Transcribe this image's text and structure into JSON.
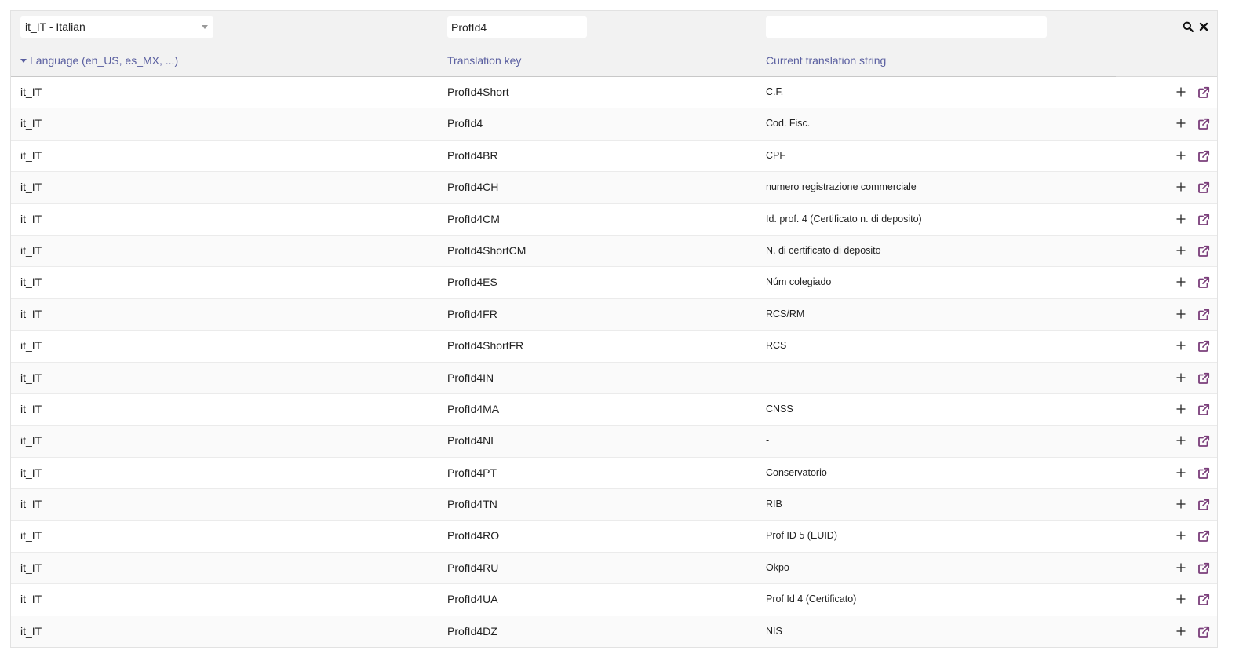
{
  "filters": {
    "language_select": "it_IT - Italian",
    "key_value": "ProfId4",
    "string_value": "",
    "search_icon": "search-icon",
    "clear_icon": "close-icon"
  },
  "columns": {
    "language": "Language (en_US, es_MX, ...)",
    "key": "Translation key",
    "string": "Current translation string"
  },
  "row_actions": {
    "add_icon": "plus-icon",
    "edit_icon": "external-link-icon",
    "accent_color": "#7a3e7a"
  },
  "rows": [
    {
      "lang": "it_IT",
      "key": "ProfId4Short",
      "string": "C.F."
    },
    {
      "lang": "it_IT",
      "key": "ProfId4",
      "string": "Cod. Fisc."
    },
    {
      "lang": "it_IT",
      "key": "ProfId4BR",
      "string": "CPF"
    },
    {
      "lang": "it_IT",
      "key": "ProfId4CH",
      "string": "numero registrazione commerciale"
    },
    {
      "lang": "it_IT",
      "key": "ProfId4CM",
      "string": "Id. prof. 4 (Certificato n. di deposito)"
    },
    {
      "lang": "it_IT",
      "key": "ProfId4ShortCM",
      "string": "N. di certificato di deposito"
    },
    {
      "lang": "it_IT",
      "key": "ProfId4ES",
      "string": "Núm colegiado"
    },
    {
      "lang": "it_IT",
      "key": "ProfId4FR",
      "string": "RCS/RM"
    },
    {
      "lang": "it_IT",
      "key": "ProfId4ShortFR",
      "string": "RCS"
    },
    {
      "lang": "it_IT",
      "key": "ProfId4IN",
      "string": "-"
    },
    {
      "lang": "it_IT",
      "key": "ProfId4MA",
      "string": "CNSS"
    },
    {
      "lang": "it_IT",
      "key": "ProfId4NL",
      "string": "-"
    },
    {
      "lang": "it_IT",
      "key": "ProfId4PT",
      "string": "Conservatorio"
    },
    {
      "lang": "it_IT",
      "key": "ProfId4TN",
      "string": "RIB"
    },
    {
      "lang": "it_IT",
      "key": "ProfId4RO",
      "string": "Prof ID 5 (EUID)"
    },
    {
      "lang": "it_IT",
      "key": "ProfId4RU",
      "string": "Okpo"
    },
    {
      "lang": "it_IT",
      "key": "ProfId4UA",
      "string": "Prof Id 4 (Certificato)"
    },
    {
      "lang": "it_IT",
      "key": "ProfId4DZ",
      "string": "NIS"
    }
  ]
}
